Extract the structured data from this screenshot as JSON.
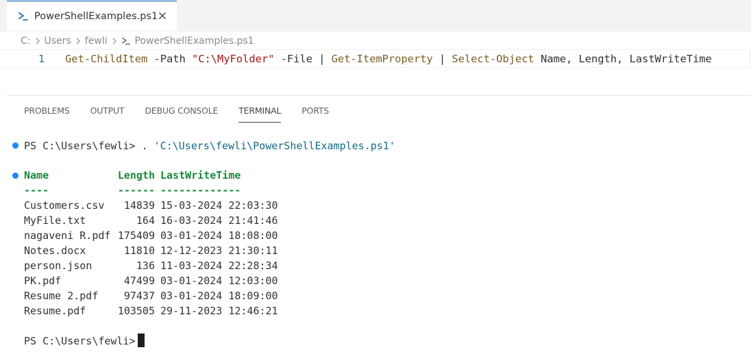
{
  "tab": {
    "icon": "powershell-icon",
    "label": "PowerShellExamples.ps1",
    "close_icon": "close-icon"
  },
  "breadcrumb": {
    "items": [
      "C:",
      "Users",
      "fewli"
    ],
    "file": "PowerShellExamples.ps1",
    "separator_icon": "chevron-right-icon"
  },
  "editor": {
    "line_number": "1",
    "tokens": [
      {
        "text": "Get-ChildItem",
        "kind": "cmd"
      },
      {
        "text": " -Path ",
        "kind": "param"
      },
      {
        "text": "\"C:\\MyFolder\"",
        "kind": "str"
      },
      {
        "text": " -File ",
        "kind": "param"
      },
      {
        "text": "| ",
        "kind": "pipe"
      },
      {
        "text": "Get-ItemProperty",
        "kind": "cmd"
      },
      {
        "text": " | ",
        "kind": "pipe"
      },
      {
        "text": "Select-Object",
        "kind": "cmd"
      },
      {
        "text": " Name, Length, LastWriteTime",
        "kind": "plain"
      }
    ]
  },
  "panel": {
    "tabs": [
      {
        "label": "PROBLEMS",
        "active": false
      },
      {
        "label": "OUTPUT",
        "active": false
      },
      {
        "label": "DEBUG CONSOLE",
        "active": false
      },
      {
        "label": "TERMINAL",
        "active": true
      },
      {
        "label": "PORTS",
        "active": false
      }
    ]
  },
  "terminal": {
    "prompt": "PS C:\\Users\\fewli> ",
    "command_prefix": ". ",
    "command_path": "'C:\\Users\\fewli\\PowerShellExamples.ps1'",
    "headers": {
      "name": "Name",
      "length": "Length",
      "time": "LastWriteTime"
    },
    "underlines": {
      "name": "----",
      "length": "------",
      "time": "-------------"
    },
    "rows": [
      {
        "name": "Customers.csv",
        "length": "14839",
        "time": "15-03-2024 22:03:30"
      },
      {
        "name": "MyFile.txt",
        "length": "164",
        "time": "16-03-2024 21:41:46"
      },
      {
        "name": "nagaveni R.pdf",
        "length": "175409",
        "time": "03-01-2024 18:08:00"
      },
      {
        "name": "Notes.docx",
        "length": "11810",
        "time": "12-12-2023 21:30:11"
      },
      {
        "name": "person.json",
        "length": "136",
        "time": "11-03-2024 22:28:34"
      },
      {
        "name": "PK.pdf",
        "length": "47499",
        "time": "03-01-2024 12:03:00"
      },
      {
        "name": "Resume 2.pdf",
        "length": "97437",
        "time": "03-01-2024 18:09:00"
      },
      {
        "name": "Resume.pdf",
        "length": "103505",
        "time": "29-11-2023 12:46:21"
      }
    ],
    "final_prompt": "PS C:\\Users\\fewli>"
  },
  "colors": {
    "accent": "#005fb8",
    "command": "#795e26",
    "string": "#a31515",
    "header": "#188a3b",
    "path": "#0f6c84",
    "dot": "#1a85ff"
  }
}
